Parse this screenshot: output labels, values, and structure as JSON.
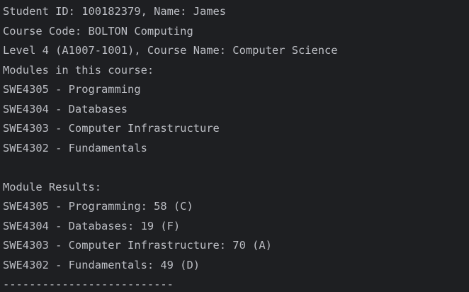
{
  "console": {
    "lines": [
      "Student ID: 100182379, Name: James",
      "Course Code: BOLTON Computing",
      "Level 4 (A1007-1001), Course Name: Computer Science",
      "Modules in this course:",
      "SWE4305 - Programming",
      "SWE4304 - Databases",
      "SWE4303 - Computer Infrastructure",
      "SWE4302 - Fundamentals",
      "",
      "Module Results:",
      "SWE4305 - Programming: 58 (C)",
      "SWE4304 - Databases: 19 (F)",
      "SWE4303 - Computer Infrastructure: 70 (A)",
      "SWE4302 - Fundamentals: 49 (D)",
      "--------------------------"
    ]
  },
  "colors": {
    "background": "#1e1f22",
    "text": "#bcbec4"
  }
}
